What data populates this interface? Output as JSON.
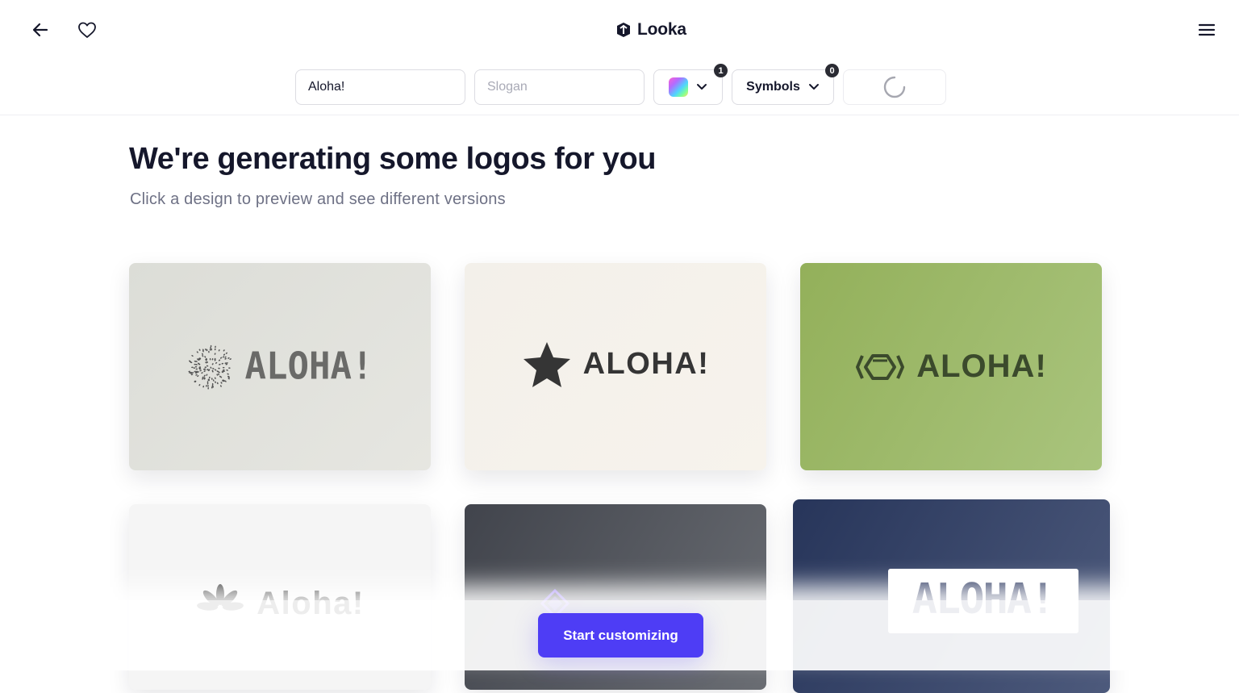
{
  "header": {
    "brand_name": "Looka",
    "icons": {
      "back": "arrow-left-icon",
      "favorite": "heart-icon",
      "menu": "hamburger-menu-icon",
      "logo": "looka-logo-icon"
    }
  },
  "toolbar": {
    "name_value": "Aloha!",
    "slogan_placeholder": "Slogan",
    "colors_count": "1",
    "symbols_label": "Symbols",
    "symbols_count": "0"
  },
  "main": {
    "heading": "We're generating some logos for you",
    "subheading": "Click a design to preview and see different versions"
  },
  "logos": [
    {
      "text": "ALOHA!",
      "symbol": "dots-circle-icon",
      "background": "#dfe0db"
    },
    {
      "text": "ALOHA!",
      "symbol": "star-icon",
      "background": "#f5f2ec"
    },
    {
      "text": "ALOHA!",
      "symbol": "hexagon-brackets-icon",
      "background": "#9fb86b"
    },
    {
      "text": "Aloha!",
      "symbol": "leaf-burst-icon",
      "background": "#f5f5f5"
    },
    {
      "text": "",
      "symbol": "diamond-icon",
      "background": "#55585f"
    },
    {
      "text": "ALOHA!",
      "symbol": "",
      "background": "#35426a"
    }
  ],
  "cta": {
    "label": "Start customizing"
  },
  "colors": {
    "accent": "#4e3df5",
    "text_dark": "#15172b",
    "text_muted": "#6e7185"
  }
}
